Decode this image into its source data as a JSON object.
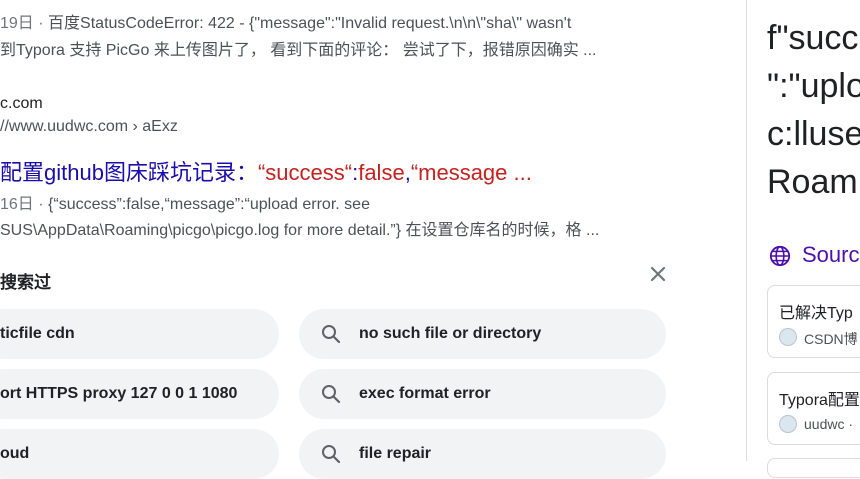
{
  "result1": {
    "date": "19日",
    "snippet_line1_rest": "百度StatusCodeError: 422 - {\"message\":\"Invalid request.\\n\\n\\\"sha\\\" wasn't",
    "snippet_line2": "到Typora 支持 PicGo 来上传图片了， 看到下面的评论： 尝试了下，报错原因确实 ..."
  },
  "result2": {
    "site_name": "c.com",
    "url": "//www.uudwc.com › aExz",
    "title_prefix": "配置github图床踩坑记录：",
    "title_hl1": "“success“",
    "title_colon": ":",
    "title_hl2": "false",
    "title_comma": ",",
    "title_hl3": "“message ...",
    "date": "16日",
    "snippet_line1_rest": "{“success”:false,“message”:“upload error. see",
    "snippet_line2": "SUS\\AppData\\Roaming\\picgo\\picgo.log for more detail.”} 在设置仓库名的时候，格 ..."
  },
  "people_also_searched": {
    "title": "搜索过",
    "items_left": [
      "ticfile cdn",
      "ort HTTPS proxy 127 0 0 1 1080",
      "oud"
    ],
    "items_right": [
      "no such file or directory",
      "exec format error",
      "file repair"
    ]
  },
  "knowledge_panel": {
    "quote_lines": [
      "f\"succ",
      "\":\"uplo",
      "c:lluse",
      "Roam"
    ],
    "sources_label": "Sourc",
    "cards": [
      {
        "title": "已解决Typ",
        "source": "CSDN博"
      },
      {
        "title": "Typora配置",
        "source": "uudwc ·"
      }
    ]
  },
  "icons": {
    "close": "close-icon",
    "search": "search-icon",
    "sources": "globe-icon",
    "favicon": "favicon-icon"
  },
  "colors": {
    "link": "#1a0dab",
    "highlight": "#c5221f",
    "sources": "#4b11a8",
    "pill_bg": "#f1f3f4"
  }
}
